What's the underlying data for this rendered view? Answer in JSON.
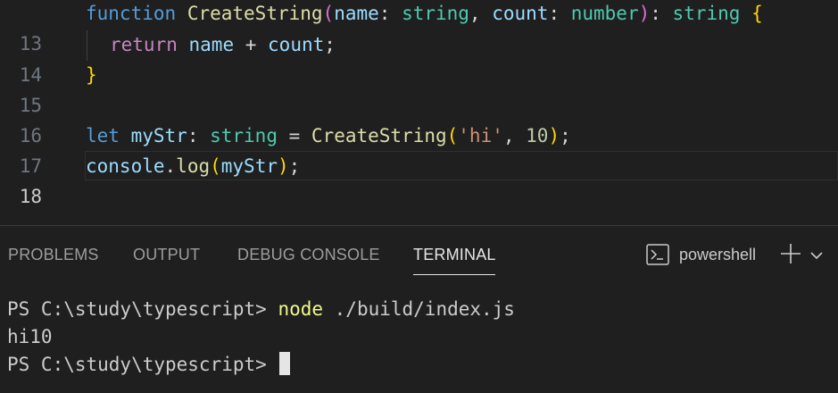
{
  "editor": {
    "lines": [
      {
        "number": "13",
        "tokens": [
          "function",
          " ",
          "CreateString",
          "(",
          "name",
          ": ",
          "string",
          ", ",
          "count",
          ": ",
          "number",
          ")",
          ": ",
          "string",
          " ",
          "{"
        ]
      },
      {
        "number": "14",
        "tokens": [
          "return",
          " ",
          "name",
          " + ",
          "count",
          ";"
        ]
      },
      {
        "number": "15",
        "tokens": [
          "}"
        ]
      },
      {
        "number": "16",
        "tokens": []
      },
      {
        "number": "17",
        "tokens": [
          "let",
          " ",
          "myStr",
          ": ",
          "string",
          " = ",
          "CreateString",
          "(",
          "'hi'",
          ", ",
          "10",
          ")",
          ";"
        ]
      },
      {
        "number": "18",
        "tokens": [
          "console",
          ".",
          "log",
          "(",
          "myStr",
          ")",
          ";"
        ]
      }
    ]
  },
  "panel": {
    "tabs": [
      "PROBLEMS",
      "OUTPUT",
      "DEBUG CONSOLE",
      "TERMINAL"
    ],
    "active_tab": "TERMINAL",
    "shell_label": "powershell"
  },
  "terminal": {
    "prompt1": "PS C:\\study\\typescript> ",
    "command": "node",
    "args": " ./build/index.js",
    "output": "hi10",
    "prompt2": "PS C:\\study\\typescript> "
  },
  "colors": {
    "background": "#1f1f1f",
    "keyword": "#569cd6",
    "control_keyword": "#c586c0",
    "function": "#dcdcaa",
    "variable": "#9cdcfe",
    "type": "#4ec9b0",
    "string": "#ce9178",
    "number": "#b5cea8",
    "brace": "#ffd700",
    "paren": "#da70d6",
    "command": "#f1fa8c"
  },
  "icons": {
    "terminal_profile": "terminal-icon",
    "new_terminal": "plus-icon",
    "profile_dropdown": "chevron-down-icon"
  }
}
